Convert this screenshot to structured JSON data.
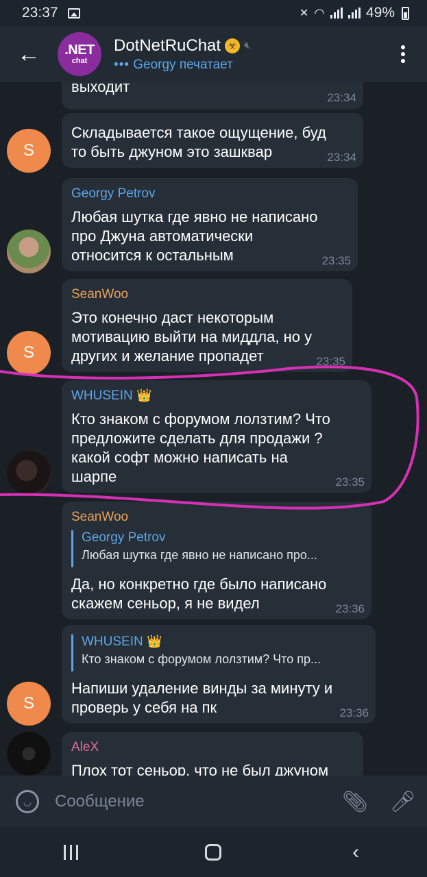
{
  "status_bar": {
    "time": "23:37",
    "battery": "49%"
  },
  "header": {
    "avatar_top": ".NET",
    "avatar_bottom": "chat",
    "title": "DotNetRuChat",
    "typing": "Georgy печатает",
    "typing_dots": "•••",
    "back_icon": "arrow-left-icon",
    "menu_icon": "more-vertical-icon"
  },
  "colors": {
    "accent": "#5ea6e8",
    "orange_name": "#e9a15b",
    "pink_name": "#e36b9b",
    "highlight": "#d631b6"
  },
  "messages": [
    {
      "sender": "",
      "lines": [
        "выходит"
      ],
      "time": "23:34"
    },
    {
      "sender": "",
      "avatar_letter": "S",
      "lines": [
        "Складывается такое ощущение, буд",
        "то быть джуном это зашквар"
      ],
      "time": "23:34"
    },
    {
      "sender": "Georgy Petrov",
      "lines": [
        "Любая шутка где явно не написано",
        "про Джуна автоматически",
        "относится к остальным"
      ],
      "time": "23:35"
    },
    {
      "sender": "SeanWoo",
      "avatar_letter": "S",
      "lines": [
        "Это конечно даст некоторым",
        "мотивацию выйти на миддла, но у",
        "других и желание пропадет"
      ],
      "time": "23:35"
    },
    {
      "sender": "WHUSEIN",
      "crown": "👑",
      "lines": [
        "Кто знаком с форумом лолзтим? Что",
        "предложите сделать для продажи ?",
        "какой софт можно написать на",
        "шарпе"
      ],
      "time": "23:35"
    },
    {
      "sender": "SeanWoo",
      "reply_name": "Georgy Petrov",
      "reply_text": "Любая шутка где явно не написано про...",
      "lines": [
        "Да, но конкретно где было написано",
        "скажем сеньор, я не видел"
      ],
      "time": "23:36"
    },
    {
      "sender": "",
      "avatar_letter": "S",
      "reply_name": "WHUSEIN",
      "reply_crown": "👑",
      "reply_text": "Кто знаком с форумом лолзтим? Что пр...",
      "lines": [
        "Напиши удаление винды за минуту и",
        "проверь у себя на пк"
      ],
      "time": "23:36"
    },
    {
      "sender": "AleX",
      "lines": [
        "Плох тот сеньор, что не был джуном"
      ],
      "time": ""
    }
  ],
  "input": {
    "placeholder": "Сообщение"
  }
}
